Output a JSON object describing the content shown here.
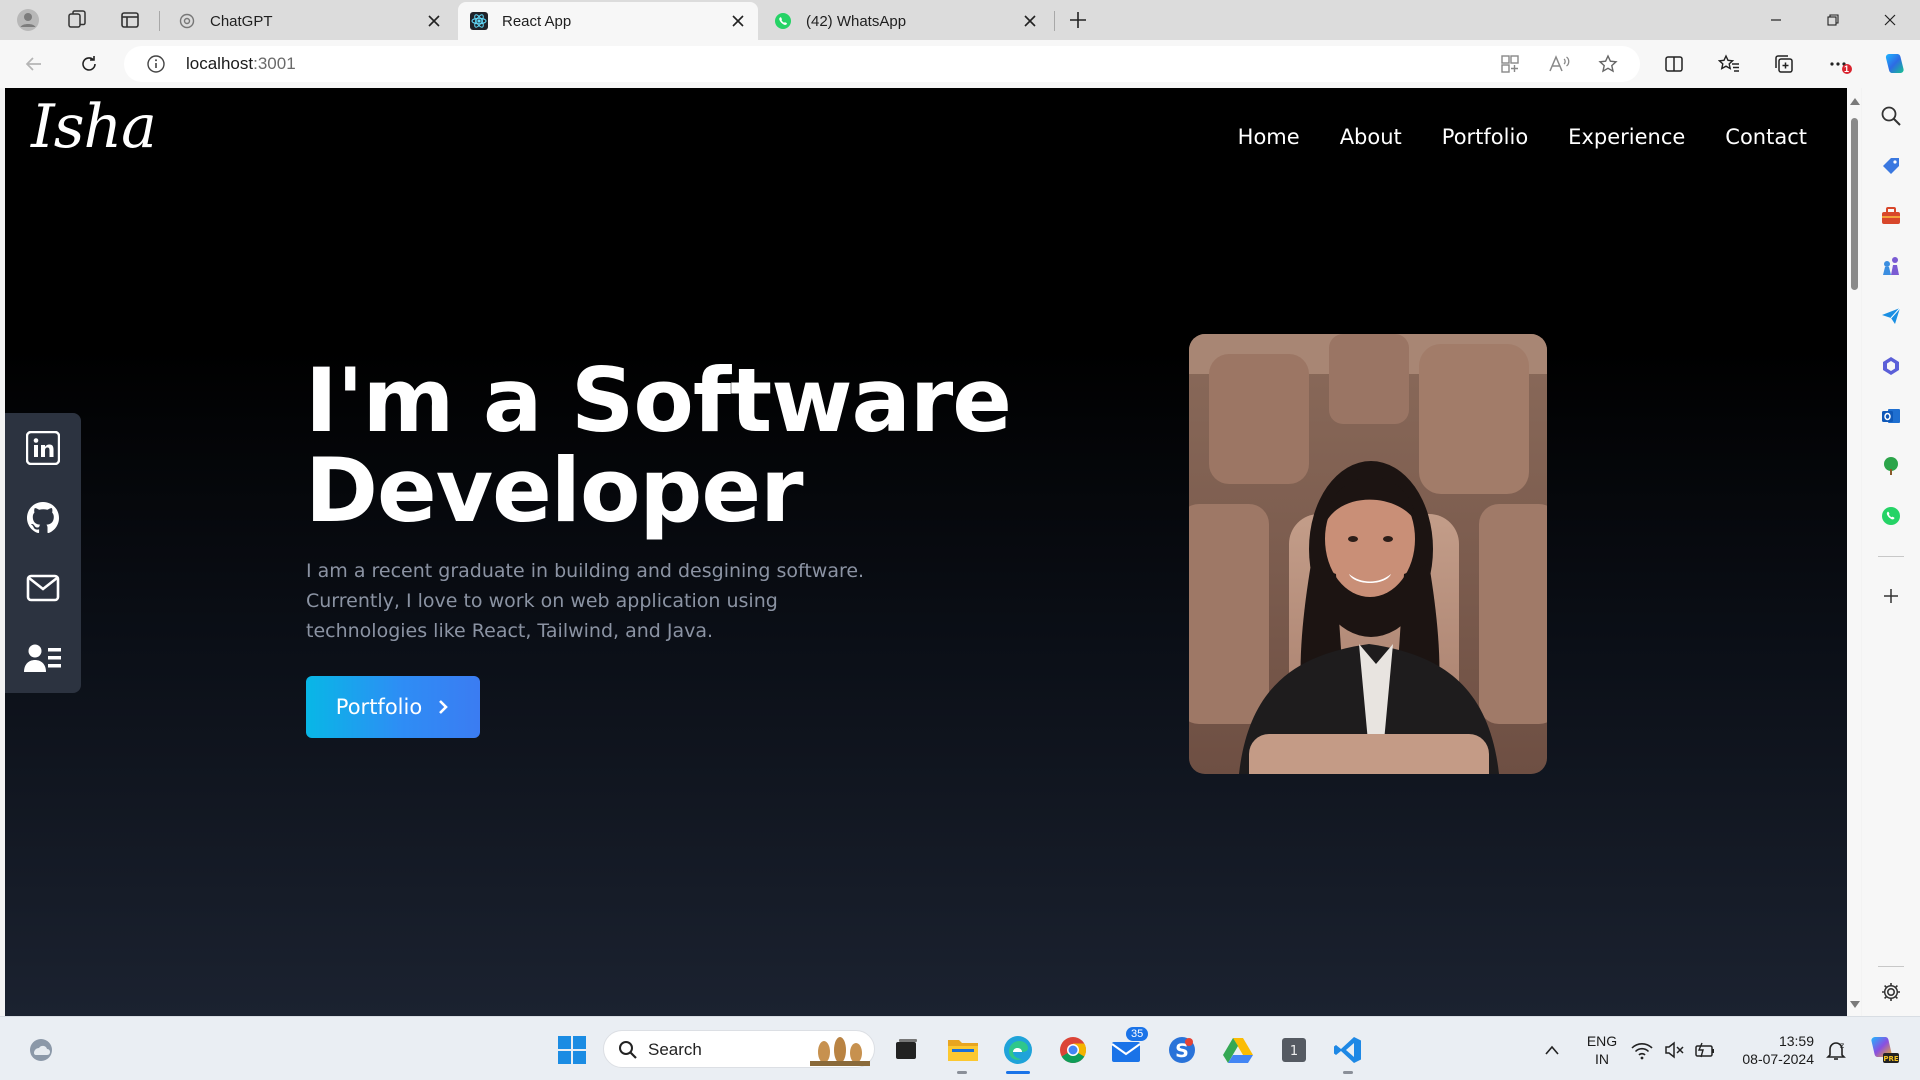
{
  "browser": {
    "tabs": [
      {
        "title": "ChatGPT",
        "active": false
      },
      {
        "title": "React App",
        "active": true
      },
      {
        "title": "(42) WhatsApp",
        "active": false
      }
    ],
    "url_host": "localhost",
    "url_port": ":3001",
    "notification_count": "1"
  },
  "site": {
    "logo": "Isha",
    "nav": [
      "Home",
      "About",
      "Portfolio",
      "Experience",
      "Contact"
    ],
    "hero": {
      "title": "I'm a Software Developer",
      "description": "I am a recent graduate in building and desgining software. Currently, I love to work on web application using technologies like React, Tailwind, and Java.",
      "cta_label": "Portfolio"
    },
    "social_icons": [
      "linkedin-icon",
      "github-icon",
      "mail-icon",
      "contact-card-icon"
    ],
    "colors": {
      "cta_start": "#08b7e6",
      "cta_end": "#3b7cf2",
      "background_top": "#000000",
      "background_bottom": "#1b2230"
    }
  },
  "taskbar": {
    "search_label": "Search",
    "mail_badge": "35",
    "lang_top": "ENG",
    "lang_bottom": "IN",
    "time": "13:59",
    "date": "08-07-2024"
  }
}
